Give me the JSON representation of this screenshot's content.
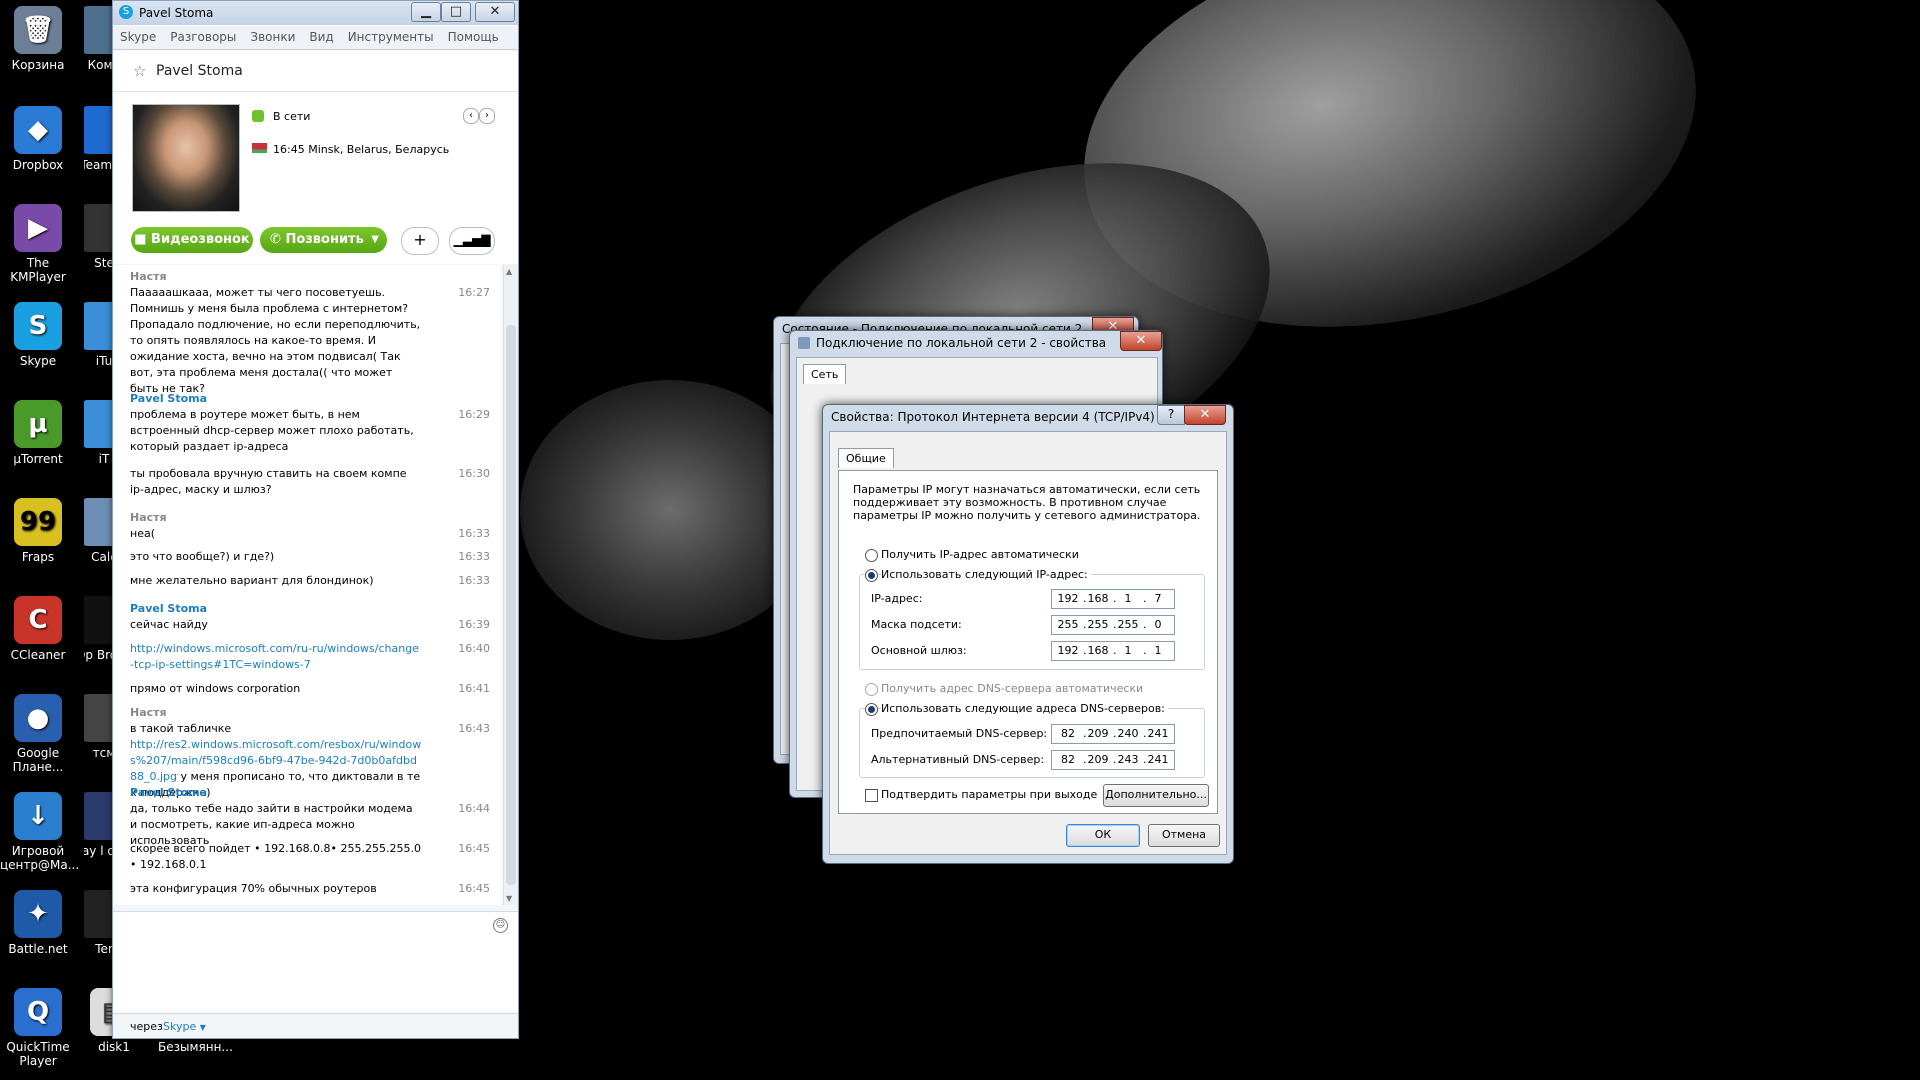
{
  "desktop": {
    "icons": [
      {
        "label": "Корзина",
        "icon": "recycle-bin-icon",
        "color": "#6d7f96"
      },
      {
        "label": "Dropbox",
        "icon": "dropbox-icon",
        "color": "#2a7ad6"
      },
      {
        "label": "The KMPlayer",
        "icon": "kmplayer-icon",
        "color": "#7a4aa8"
      },
      {
        "label": "Skype",
        "icon": "skype-icon",
        "color": "#1aa0e0"
      },
      {
        "label": "µTorrent",
        "icon": "utorrent-icon",
        "color": "#4a9a2a"
      },
      {
        "label": "Fraps",
        "icon": "fraps-icon",
        "color": "#d8c020"
      },
      {
        "label": "CCleaner",
        "icon": "ccleaner-icon",
        "color": "#c8342a"
      },
      {
        "label": "Google Плане...",
        "icon": "google-earth-icon",
        "color": "#2a5fb0"
      },
      {
        "label": "Игровой центр@Ma...",
        "icon": "game-center-icon",
        "color": "#2a7fd0"
      },
      {
        "label": "Battle.net",
        "icon": "battlenet-icon",
        "color": "#1f5aa8"
      },
      {
        "label": "QuickTime Player",
        "icon": "quicktime-icon",
        "color": "#2a6fd0"
      }
    ],
    "icons2": [
      {
        "label": "Комп",
        "icon": "computer-icon"
      },
      {
        "label": "Team Cl",
        "icon": "teamviewer-icon"
      },
      {
        "label": "Ste",
        "icon": "steam-icon"
      },
      {
        "label": "iTu",
        "icon": "itunes-icon"
      },
      {
        "label": "iT",
        "icon": "itunes2-icon"
      },
      {
        "label": "Calc",
        "icon": "calculator-icon"
      },
      {
        "label": "Op Broad",
        "icon": "opera-icon"
      },
      {
        "label": "тсм",
        "icon": "settings-icon"
      },
      {
        "label": "Play l of Le",
        "icon": "game-icon"
      },
      {
        "label": "Ter",
        "icon": "terminal-icon"
      },
      {
        "label": "disk1",
        "icon": "disk-icon"
      }
    ],
    "extra_label": "Безымянн..."
  },
  "skype": {
    "window_title": "Pavel Stoma",
    "menu": [
      "Skype",
      "Разговоры",
      "Звонки",
      "Вид",
      "Инструменты",
      "Помощь"
    ],
    "contact_name": "Pavel Stoma",
    "status": "В сети",
    "location": "16:45 Minsk, Belarus, Беларусь",
    "buttons": {
      "video": "Видеозвонок",
      "call": "Позвонить",
      "add": "+",
      "signal": "▮"
    },
    "messages": [
      {
        "sender": "Настя",
        "me": false,
        "text": "Пааааашкааа, может ты чего посоветуешь. Помнишь у меня была проблема с интернетом? Пропадало подлючение, но если переподлючить, то опять появлялось на какое-то время. И ожидание хоста, вечно на этом подвисал( Так вот, эта проблема меня достала(( что может быть не так?",
        "time": "16:27"
      },
      {
        "sender": "Pavel Stoma",
        "me": true,
        "text": "проблема в роутере может быть, в нем встроенный dhcp-сервер может плохо работать, который раздает ip-адреса",
        "time": "16:29"
      },
      {
        "sender": "",
        "me": true,
        "text": "ты пробовала вручную ставить на своем компе ip-адрес, маску и шлюз?",
        "time": "16:30"
      },
      {
        "sender": "Настя",
        "me": false,
        "text": "неа(",
        "time": "16:33"
      },
      {
        "sender": "",
        "me": false,
        "text": "это что вообще?) и где?)",
        "time": "16:33"
      },
      {
        "sender": "",
        "me": false,
        "text": "мне желательно вариант для блондинок)",
        "time": "16:33"
      },
      {
        "sender": "Pavel Stoma",
        "me": true,
        "text": "сейчас найду",
        "time": "16:39"
      },
      {
        "sender": "",
        "me": true,
        "text": "http://windows.microsoft.com/ru-ru/windows/change-tcp-ip-settings#1TC=windows-7",
        "time": "16:40",
        "link": true
      },
      {
        "sender": "",
        "me": true,
        "text": "прямо от windows corporation",
        "time": "16:41"
      },
      {
        "sender": "Настя",
        "me": false,
        "text": "в такой табличке",
        "time": "16:43"
      },
      {
        "sender": "",
        "me": false,
        "text": "http://res2.windows.microsoft.com/resbox/ru/windows%207/main/f598cd96-6bf9-47be-942d-7d0b0afdbd88_0.jpg",
        "suffix": " у меня прописано то, что диктовали в тех поддержке)",
        "time": "",
        "link": true
      },
      {
        "sender": "Pavel Stoma",
        "me": true,
        "text": "да, только тебе надо зайти в настройки модема и посмотреть, какие ип-адреса можно использовать",
        "time": "16:44"
      },
      {
        "sender": "",
        "me": true,
        "text": "скорее всего пойдет • 192.168.0.8• 255.255.255.0 • 192.168.0.1",
        "time": "16:45"
      },
      {
        "sender": "",
        "me": true,
        "text": "эта конфигурация 70% обычных роутеров",
        "time": "16:45"
      }
    ],
    "via_prefix": "через",
    "via_link": "Skype"
  },
  "dialogs": {
    "status_title": "Состояние - Подключение по локальной сети 2",
    "props_title": "Подключение по локальной сети 2 - свойства",
    "props_tab": "Сеть",
    "ipv4": {
      "title": "Свойства: Протокол Интернета версии 4 (TCP/IPv4)",
      "tab": "Общие",
      "description": "Параметры IP могут назначаться автоматически, если сеть поддерживает эту возможность. В противном случае параметры IP можно получить у сетевого администратора.",
      "radio_auto_ip": "Получить IP-адрес автоматически",
      "radio_manual_ip": "Использовать следующий IP-адрес:",
      "ip_label": "IP-адрес:",
      "ip": [
        "192",
        "168",
        "1",
        "7"
      ],
      "mask_label": "Маска подсети:",
      "mask": [
        "255",
        "255",
        "255",
        "0"
      ],
      "gateway_label": "Основной шлюз:",
      "gateway": [
        "192",
        "168",
        "1",
        "1"
      ],
      "radio_auto_dns": "Получить адрес DNS-сервера автоматически",
      "radio_manual_dns": "Использовать следующие адреса DNS-серверов:",
      "dns1_label": "Предпочитаемый DNS-сервер:",
      "dns1": [
        "82",
        "209",
        "240",
        "241"
      ],
      "dns2_label": "Альтернативный DNS-сервер:",
      "dns2": [
        "82",
        "209",
        "243",
        "241"
      ],
      "validate_label": "Подтвердить параметры при выходе",
      "advanced_button": "Дополнительно...",
      "ok_button": "ОК",
      "cancel_button": "Отмена"
    }
  }
}
